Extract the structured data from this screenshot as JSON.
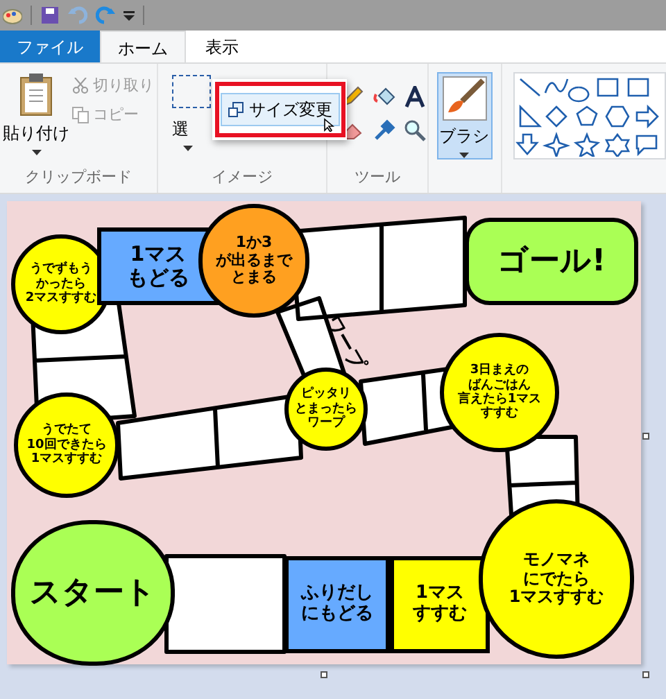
{
  "tabs": [
    {
      "label": "ファイル",
      "kind": "file",
      "selected": false
    },
    {
      "label": "ホーム",
      "kind": "tab",
      "selected": true
    },
    {
      "label": "表示",
      "kind": "tab",
      "selected": false
    }
  ],
  "clipboard": {
    "paste": "貼り付け",
    "cut": {
      "label": "切り取り",
      "disabled": true
    },
    "copy": {
      "label": "コピー",
      "disabled": true
    },
    "group_label": "クリップボード"
  },
  "image_group": {
    "select": "選",
    "group_label": "イメージ"
  },
  "popup": {
    "resize_button": {
      "label": "サイズ変更",
      "highlighted": true
    }
  },
  "tools": {
    "group_label": "ツール"
  },
  "brush": {
    "label": "ブラシ",
    "selected": true
  },
  "board": {
    "warp_label": "ワープ",
    "spaces": [
      {
        "kind": "circle",
        "color": "#ffff00",
        "lines": [
          "うでずもう",
          "かったら",
          "2マスすすむ"
        ]
      },
      {
        "kind": "square",
        "color": "#66aaff",
        "lines": [
          "1マス",
          "もどる"
        ]
      },
      {
        "kind": "circle",
        "color": "#ffa020",
        "lines": [
          "1か3",
          "が出るまで",
          "とまる"
        ]
      },
      {
        "kind": "goal",
        "color": "#aaff55",
        "lines": [
          "ゴール!"
        ]
      },
      {
        "kind": "circle",
        "color": "#ffff00",
        "lines": [
          "ピッタリ",
          "とまったら",
          "ワープ"
        ]
      },
      {
        "kind": "circle",
        "color": "#ffff00",
        "lines": [
          "3日まえの",
          "ばんごはん",
          "言えたら1マス",
          "すすむ"
        ]
      },
      {
        "kind": "circle",
        "color": "#ffff00",
        "lines": [
          "うでたて",
          "10回できたら",
          "1マスすすむ"
        ]
      },
      {
        "kind": "start",
        "color": "#aaff55",
        "lines": [
          "スタート"
        ]
      },
      {
        "kind": "square",
        "color": "#66aaff",
        "lines": [
          "ふりだし",
          "にもどる"
        ]
      },
      {
        "kind": "square",
        "color": "#ffff00",
        "lines": [
          "1マス",
          "すすむ"
        ]
      },
      {
        "kind": "circle",
        "color": "#ffff00",
        "lines": [
          "モノマネ",
          "にでたら",
          "1マスすすむ"
        ]
      }
    ]
  }
}
